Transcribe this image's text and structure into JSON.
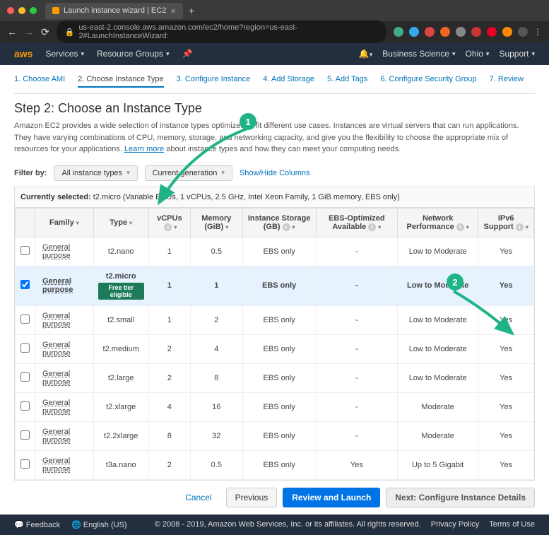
{
  "browser": {
    "tab_title": "Launch instance wizard | EC2",
    "url": "us-east-2.console.aws.amazon.com/ec2/home?region=us-east-2#LaunchInstanceWizard:"
  },
  "aws_header": {
    "logo": "aws",
    "services": "Services",
    "resource_groups": "Resource Groups",
    "account": "Business Science",
    "region": "Ohio",
    "support": "Support"
  },
  "wizard": {
    "steps": [
      "1. Choose AMI",
      "2. Choose Instance Type",
      "3. Configure Instance",
      "4. Add Storage",
      "5. Add Tags",
      "6. Configure Security Group",
      "7. Review"
    ],
    "active_step_index": 1,
    "title": "Step 2: Choose an Instance Type",
    "description": "Amazon EC2 provides a wide selection of instance types optimized to fit different use cases. Instances are virtual servers that can run applications. They have varying combinations of CPU, memory, storage, and networking capacity, and give you the flexibility to choose the appropriate mix of resources for your applications.",
    "learn_more": "Learn more",
    "description_tail": " about instance types and how they can meet your computing needs.",
    "filter_label": "Filter by:",
    "filter_all": "All instance types",
    "filter_gen": "Current generation",
    "show_hide": "Show/Hide Columns",
    "currently_selected_label": "Currently selected:",
    "currently_selected_value": "t2.micro (Variable ECUs, 1 vCPUs, 2.5 GHz, Intel Xeon Family, 1 GiB memory, EBS only)"
  },
  "table": {
    "headers": {
      "family": "Family",
      "type": "Type",
      "vcpus": "vCPUs",
      "memory": "Memory (GiB)",
      "storage": "Instance Storage (GB)",
      "ebs": "EBS-Optimized Available",
      "network": "Network Performance",
      "ipv6": "IPv6 Support"
    },
    "free_tier_label": "Free tier eligible",
    "rows": [
      {
        "selected": false,
        "family": "General purpose",
        "type": "t2.nano",
        "vcpus": "1",
        "memory": "0.5",
        "storage": "EBS only",
        "ebs": "-",
        "network": "Low to Moderate",
        "ipv6": "Yes"
      },
      {
        "selected": true,
        "family": "General purpose",
        "type": "t2.micro",
        "free_tier": true,
        "vcpus": "1",
        "memory": "1",
        "storage": "EBS only",
        "ebs": "-",
        "network": "Low to Moderate",
        "ipv6": "Yes"
      },
      {
        "selected": false,
        "family": "General purpose",
        "type": "t2.small",
        "vcpus": "1",
        "memory": "2",
        "storage": "EBS only",
        "ebs": "-",
        "network": "Low to Moderate",
        "ipv6": "Yes"
      },
      {
        "selected": false,
        "family": "General purpose",
        "type": "t2.medium",
        "vcpus": "2",
        "memory": "4",
        "storage": "EBS only",
        "ebs": "-",
        "network": "Low to Moderate",
        "ipv6": "Yes"
      },
      {
        "selected": false,
        "family": "General purpose",
        "type": "t2.large",
        "vcpus": "2",
        "memory": "8",
        "storage": "EBS only",
        "ebs": "-",
        "network": "Low to Moderate",
        "ipv6": "Yes"
      },
      {
        "selected": false,
        "family": "General purpose",
        "type": "t2.xlarge",
        "vcpus": "4",
        "memory": "16",
        "storage": "EBS only",
        "ebs": "-",
        "network": "Moderate",
        "ipv6": "Yes"
      },
      {
        "selected": false,
        "family": "General purpose",
        "type": "t2.2xlarge",
        "vcpus": "8",
        "memory": "32",
        "storage": "EBS only",
        "ebs": "-",
        "network": "Moderate",
        "ipv6": "Yes"
      },
      {
        "selected": false,
        "family": "General purpose",
        "type": "t3a.nano",
        "vcpus": "2",
        "memory": "0.5",
        "storage": "EBS only",
        "ebs": "Yes",
        "network": "Up to 5 Gigabit",
        "ipv6": "Yes"
      }
    ]
  },
  "buttons": {
    "cancel": "Cancel",
    "previous": "Previous",
    "review": "Review and Launch",
    "next": "Next: Configure Instance Details"
  },
  "footer": {
    "feedback": "Feedback",
    "language": "English (US)",
    "copyright": "© 2008 - 2019, Amazon Web Services, Inc. or its affiliates. All rights reserved.",
    "privacy": "Privacy Policy",
    "terms": "Terms of Use"
  },
  "annotations": {
    "one": "1",
    "two": "2"
  }
}
